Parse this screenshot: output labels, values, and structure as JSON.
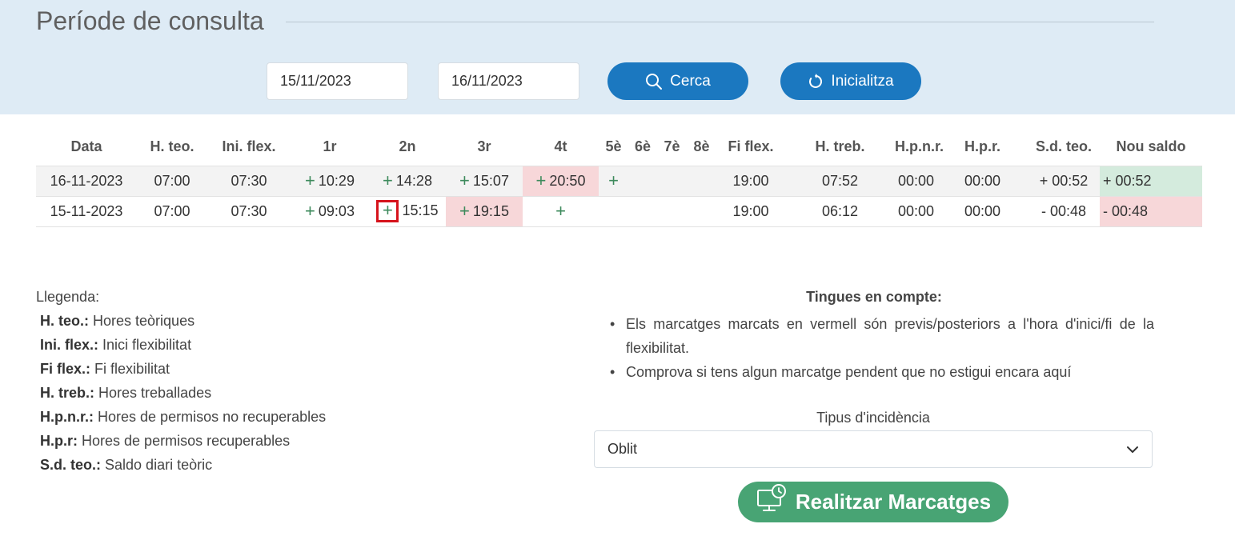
{
  "filter": {
    "title": "Període de consulta",
    "date_from": "15/11/2023",
    "date_to": "16/11/2023",
    "search_label": "Cerca",
    "reset_label": "Inicialitza",
    "search_icon": "search-icon",
    "reset_icon": "refresh-icon"
  },
  "table": {
    "headers": [
      "Data",
      "H. teo.",
      "Ini. flex.",
      "1r",
      "2n",
      "3r",
      "4t",
      "5è",
      "6è",
      "7è",
      "8è",
      "Fi flex.",
      "H. treb.",
      "H.p.n.r.",
      "H.p.r.",
      "S.d. teo.",
      "Nou saldo"
    ],
    "rows": [
      {
        "date": "16-11-2023",
        "h_teo": "07:00",
        "ini_flex": "07:30",
        "p1": "10:29",
        "p2": "14:28",
        "p3": "15:07",
        "p4": "20:50",
        "fi_flex": "19:00",
        "h_treb": "07:52",
        "hpnr": "00:00",
        "hpr": "00:00",
        "sd_teo": "+ 00:52",
        "nou_saldo": "+ 00:52"
      },
      {
        "date": "15-11-2023",
        "h_teo": "07:00",
        "ini_flex": "07:30",
        "p1": "09:03",
        "p2": "15:15",
        "p3": "19:15",
        "fi_flex": "19:00",
        "h_treb": "06:12",
        "hpnr": "00:00",
        "hpr": "00:00",
        "sd_teo": "- 00:48",
        "nou_saldo": "- 00:48"
      }
    ],
    "plus_glyph": "+"
  },
  "legend": {
    "heading": "Llegenda:",
    "items": [
      {
        "term": "H. teo.:",
        "desc": "Hores teòriques"
      },
      {
        "term": "Ini. flex.:",
        "desc": "Inici flexibilitat"
      },
      {
        "term": "Fi flex.:",
        "desc": "Fi flexibilitat"
      },
      {
        "term": "H. treb.:",
        "desc": "Hores treballades"
      },
      {
        "term": "H.p.n.r.:",
        "desc": "Hores de permisos no recuperables"
      },
      {
        "term": "H.p.r:",
        "desc": "Hores de permisos recuperables"
      },
      {
        "term": "S.d. teo.:",
        "desc": "Saldo diari teòric"
      }
    ]
  },
  "notes": {
    "title": "Tingues en compte:",
    "items": [
      "Els marcatges marcats en vermell són previs/posteriors a l'hora d'inici/fi de la flexibilitat.",
      "Comprova si tens algun marcatge pendent que no estigui encara aquí"
    ]
  },
  "incidence": {
    "label": "Tipus d'incidència",
    "selected": "Oblit",
    "chevron_icon": "chevron-down-icon",
    "punch_button": "Realitzar Marcatges",
    "punch_icon": "computer-clock-icon"
  },
  "colors": {
    "band_bg": "#deebf5",
    "primary": "#1b78c0",
    "success": "#48a474",
    "plus": "#3d8a5c",
    "late_cell": "#f7d7d9",
    "positive_cell": "#d4ebdd",
    "highlight_box": "#d6131c"
  }
}
